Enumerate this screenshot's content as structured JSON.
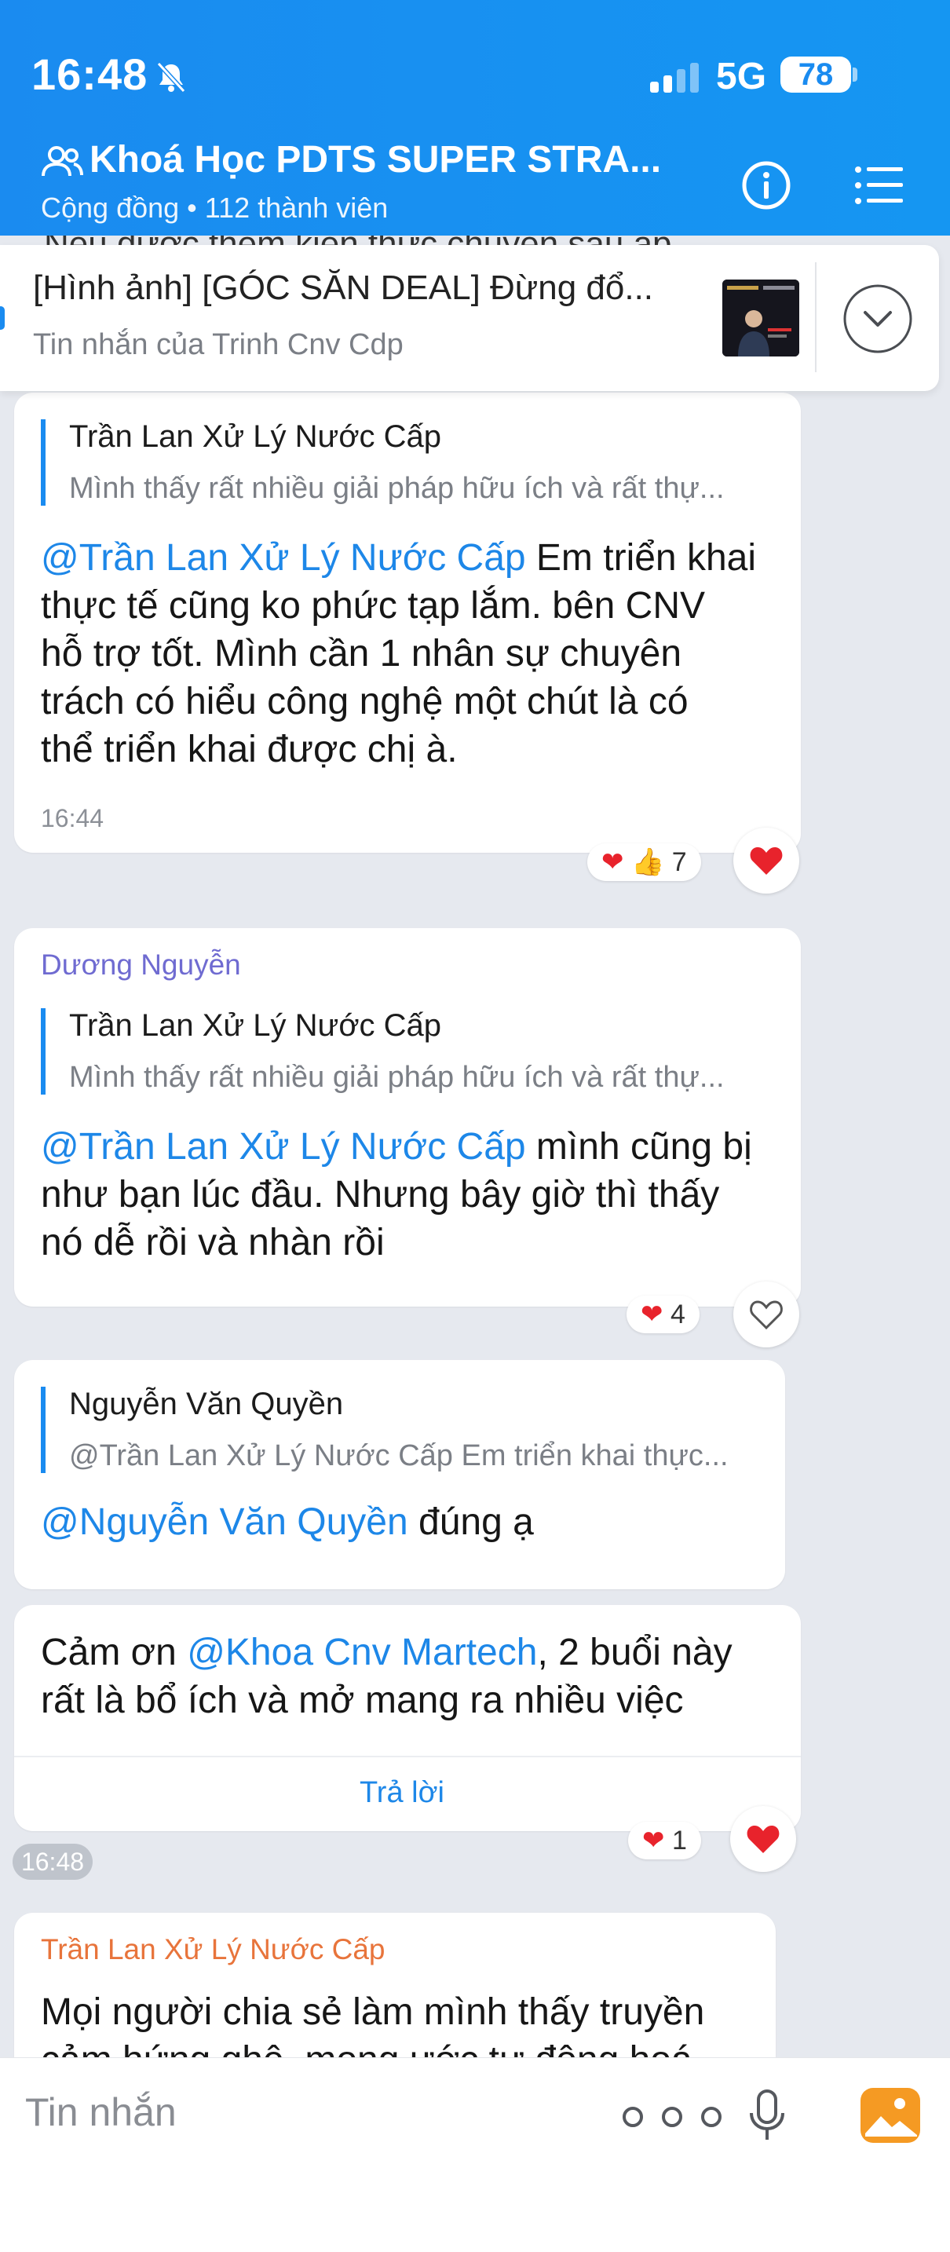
{
  "status": {
    "time": "16:48",
    "network": "5G",
    "battery": "78"
  },
  "header": {
    "title": "Khoá Học PDTS SUPER STRA...",
    "subtitle": "Cộng đồng • 112 thành viên"
  },
  "peek_text": "Nếu được thêm kiến thức chuyên sâu áp",
  "pinned": {
    "title": "[Hình ảnh] [GÓC SĂN DEAL] Đừng đổ...",
    "subtitle": "Tin nhắn của Trinh Cnv Cdp"
  },
  "messages": [
    {
      "quote_name": "Trần Lan Xử Lý Nước Cấp",
      "quote_text": "Mình thấy rất nhiều giải pháp hữu ích và rất thự...",
      "mention": "@Trần Lan Xử Lý Nước Cấp",
      "line1": " Em triển khai",
      "line2": "thực tế cũng ko phức tạp lắm. bên CNV",
      "line3": "hỗ trợ tốt. Mình cần 1 nhân sự chuyên",
      "line4": "trách có hiểu công nghệ một chút là có",
      "line5": "thể triển khai được chị à.",
      "time": "16:44",
      "reaction_count": "7"
    },
    {
      "sender": "Dương Nguyễn",
      "quote_name": "Trần Lan Xử Lý Nước Cấp",
      "quote_text": "Mình thấy rất nhiều giải pháp hữu ích và rất thự...",
      "mention": "@Trần Lan Xử Lý Nước Cấp",
      "line1": " mình cũng bị",
      "line2": "như bạn lúc đầu. Nhưng bây giờ thì thấy",
      "line3": "nó dễ rồi  và nhàn rồi",
      "reaction_count": "4"
    },
    {
      "quote_name": "Nguyễn Văn Quyền",
      "quote_text": "@Trần Lan Xử Lý Nước Cấp Em triển khai thực...",
      "mention": "@Nguyễn Văn Quyền",
      "line1": " đúng ạ"
    },
    {
      "prefix": "Cảm ơn ",
      "mention": "@Khoa Cnv Martech",
      "line1": ", 2 buổi này",
      "line2": "rất là bổ ích và mở mang ra nhiều việc",
      "reply_label": "Trả lời",
      "time": "16:48",
      "reaction_count": "1"
    },
    {
      "sender": "Trần Lan Xử Lý Nước Cấp",
      "line1": "Mọi người chia sẻ làm mình thấy truyền",
      "line2": "cảm hứng ghê, mong ước tự động hoá"
    }
  ],
  "composer": {
    "placeholder": "Tin nhắn"
  },
  "colors": {
    "header_blue": "#1a8bf0",
    "mention_blue": "#1d87e8",
    "sender_purple": "#6f6bd1",
    "sender_orange": "#e8743b",
    "heart_red": "#e8232c"
  },
  "icons": [
    "bell-off-icon",
    "signal-icon",
    "group-icon",
    "info-icon",
    "menu-icon",
    "chevron-down-icon",
    "heart-icon",
    "thumbs-up-icon",
    "more-icon",
    "microphone-icon",
    "image-icon"
  ]
}
